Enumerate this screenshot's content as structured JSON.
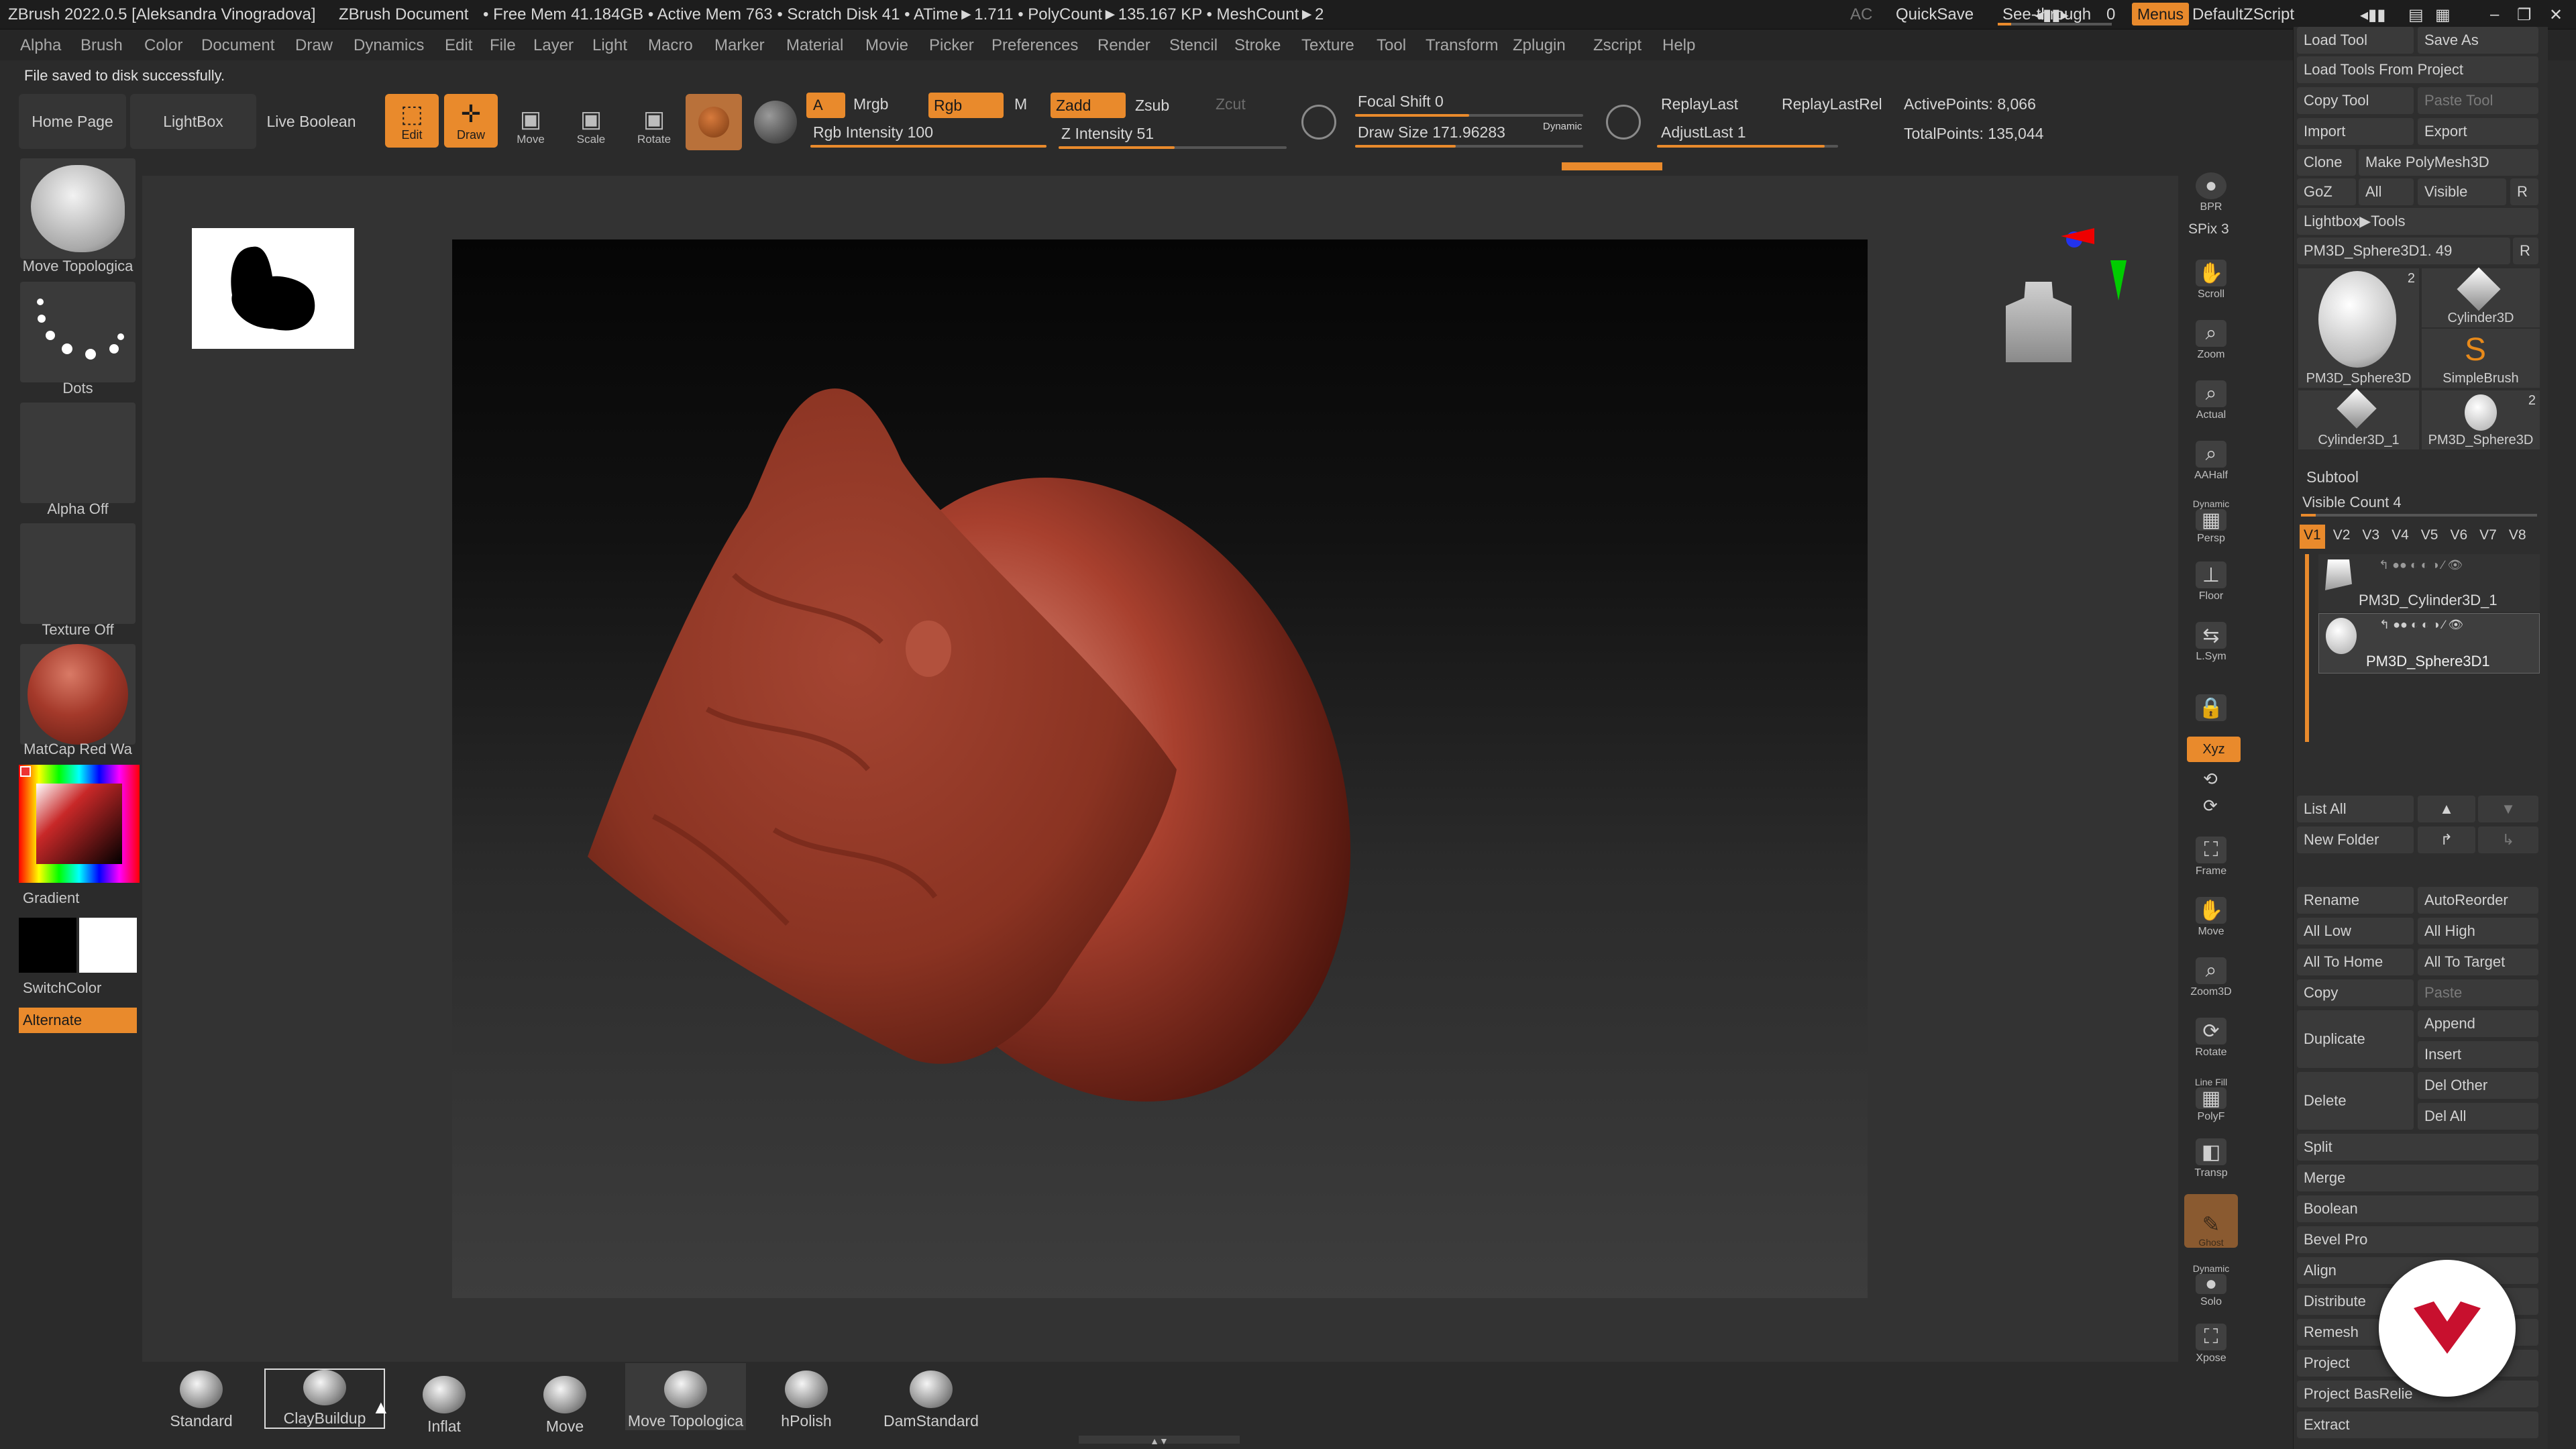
{
  "titlebar": {
    "app": "ZBrush 2022.0.5 [Aleksandra Vinogradova]",
    "doc": "ZBrush Document",
    "stats": "• Free Mem 41.184GB • Active Mem 763 • Scratch Disk 41 • ATime►1.711 • PolyCount►135.167 KP • MeshCount►2",
    "ac": "AC",
    "quicksave": "QuickSave",
    "seethrough": "See-through",
    "seethrough_val": "0",
    "menus": "Menus",
    "script": "DefaultZScript"
  },
  "menubar": [
    "Alpha",
    "Brush",
    "Color",
    "Document",
    "Draw",
    "Dynamics",
    "Edit",
    "File",
    "Layer",
    "Light",
    "Macro",
    "Marker",
    "Material",
    "Movie",
    "Picker",
    "Preferences",
    "Render",
    "Stencil",
    "Stroke",
    "Texture",
    "Tool",
    "Transform",
    "Zplugin",
    "Zscript",
    "Help"
  ],
  "status": "File saved to disk successfully.",
  "toolbar": {
    "home": "Home Page",
    "lightbox": "LightBox",
    "liveboolean": "Live Boolean",
    "edit": "Edit",
    "draw": "Draw",
    "move": "Move",
    "scale": "Scale",
    "rotate": "Rotate",
    "a": "A",
    "mrgb": "Mrgb",
    "rgb": "Rgb",
    "m": "M",
    "rgb_intensity": "Rgb Intensity 100",
    "zadd": "Zadd",
    "zsub": "Zsub",
    "zcut": "Zcut",
    "z_intensity": "Z Intensity 51",
    "focal_shift": "Focal Shift 0",
    "draw_size": "Draw Size 171.96283",
    "dynamic": "Dynamic",
    "replaylast": "ReplayLast",
    "replaylastrel": "ReplayLastRel",
    "adjustlast": "AdjustLast 1",
    "activepoints": "ActivePoints: 8,066",
    "totalpoints": "TotalPoints: 135,044",
    "rgb_intensity_frac": 1.0,
    "z_intensity_frac": 0.51
  },
  "leftshelf": {
    "tool_label": "Move Topologica",
    "stroke_label": "Dots",
    "alpha_label": "Alpha Off",
    "texture_label": "Texture Off",
    "material_label": "MatCap Red Wa",
    "gradient_label": "Gradient",
    "switchcolor_label": "SwitchColor",
    "alternate_label": "Alternate"
  },
  "righttools": [
    "BPR",
    "SPix 3",
    "Scroll",
    "Zoom",
    "Actual",
    "AAHalf",
    "Persp",
    "Floor",
    "L.Sym",
    "",
    "Xyz",
    "",
    "",
    "Frame",
    "Move",
    "Zoom3D",
    "Rotate",
    "PolyF",
    "Transp",
    "Ghost",
    "Solo",
    "Xpose"
  ],
  "righttool_extra": {
    "dynamic": "Dynamic",
    "linefill": "Line Fill",
    "dynamic2": "Dynamic"
  },
  "tray": {
    "load_tool": "Load Tool",
    "save_as": "Save As",
    "load_from_project": "Load Tools From Project",
    "copy_tool": "Copy Tool",
    "paste_tool": "Paste Tool",
    "import": "Import",
    "export": "Export",
    "clone": "Clone",
    "make_polymesh": "Make PolyMesh3D",
    "goz": "GoZ",
    "all": "All",
    "visible": "Visible",
    "r": "R",
    "lightbox_tools": "Lightbox▶Tools",
    "current_tool": "PM3D_Sphere3D1. 49",
    "r2": "R",
    "tools": [
      {
        "label": "PM3D_Sphere3D",
        "count": "2"
      },
      {
        "label": "Cylinder3D",
        "count": ""
      },
      {
        "label": "SimpleBrush",
        "count": ""
      },
      {
        "label": "Cylinder3D_1",
        "count": ""
      },
      {
        "label": "PM3D_Sphere3D",
        "count": "2"
      }
    ],
    "subtool": "Subtool",
    "visible_count": "Visible Count 4",
    "versions": [
      "V1",
      "V2",
      "V3",
      "V4",
      "V5",
      "V6",
      "V7",
      "V8"
    ],
    "subtools": [
      "PM3D_Cylinder3D_1",
      "PM3D_Sphere3D1"
    ],
    "list_all": "List All",
    "new_folder": "New Folder",
    "rename": "Rename",
    "autoreorder": "AutoReorder",
    "all_low": "All Low",
    "all_high": "All High",
    "all_to_home": "All To Home",
    "all_to_target": "All To Target",
    "copy": "Copy",
    "paste": "Paste",
    "duplicate": "Duplicate",
    "append": "Append",
    "insert": "Insert",
    "delete": "Delete",
    "del_other": "Del Other",
    "del_all": "Del All",
    "split": "Split",
    "merge": "Merge",
    "boolean": "Boolean",
    "bevel_pro": "Bevel Pro",
    "align": "Align",
    "distribute": "Distribute",
    "remesh": "Remesh",
    "project": "Project",
    "project_basrelief": "Project BasRelie",
    "extract": "Extract"
  },
  "brushes": [
    "Standard",
    "ClayBuildup",
    "Inflat",
    "Move",
    "Move Topologica",
    "hPolish",
    "DamStandard"
  ],
  "colors": {
    "accent": "#e98a2c",
    "clay": "#9a3a2a",
    "logo": "#c8102e"
  }
}
